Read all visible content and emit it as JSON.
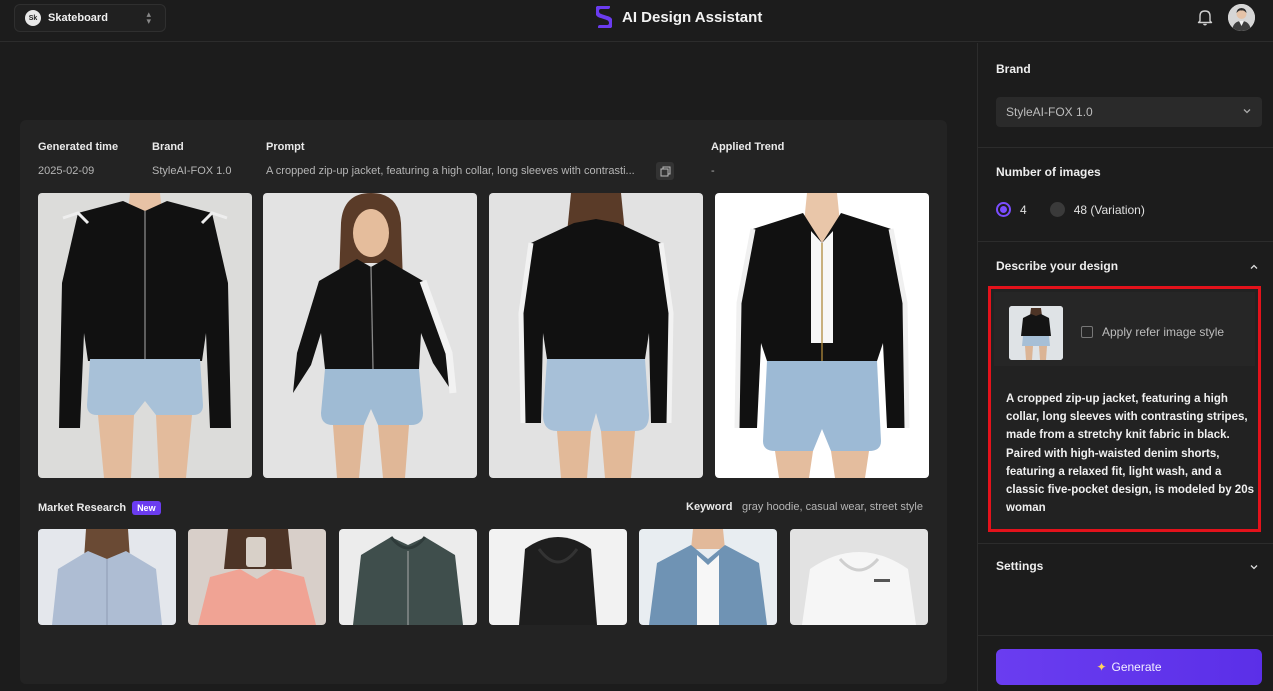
{
  "header": {
    "workspace_initials": "Sk",
    "workspace_name": "Skateboard",
    "app_title": "AI Design Assistant"
  },
  "result": {
    "headers": {
      "generated_time": "Generated time",
      "brand": "Brand",
      "prompt": "Prompt",
      "applied_trend": "Applied Trend"
    },
    "values": {
      "generated_time": "2025-02-09",
      "brand": "StyleAI-FOX 1.0",
      "prompt": "A cropped zip-up jacket, featuring a high collar, long sleeves with contrasti...",
      "applied_trend": "-"
    }
  },
  "market_research": {
    "label": "Market Research",
    "badge": "New",
    "keyword_label": "Keyword",
    "keyword_value": "gray hoodie, casual wear, street style"
  },
  "panel": {
    "brand_title": "Brand",
    "brand_value": "StyleAI-FOX 1.0",
    "num_images_title": "Number of images",
    "option_1": "4",
    "option_2": "48 (Variation)",
    "describe_title": "Describe your design",
    "apply_ref_label": "Apply refer image style",
    "prompt_text": "A cropped zip-up jacket, featuring a high collar, long sleeves with contrasting stripes, made from a stretchy knit fabric in black. Paired with high-waisted denim shorts, featuring a relaxed fit, light wash, and a classic five-pocket design, is modeled by 20s woman",
    "settings_title": "Settings",
    "generate_label": "Generate"
  },
  "colors": {
    "accent": "#7b4dff",
    "highlight_border": "#e3121b",
    "badge": "#6b3cf0"
  }
}
